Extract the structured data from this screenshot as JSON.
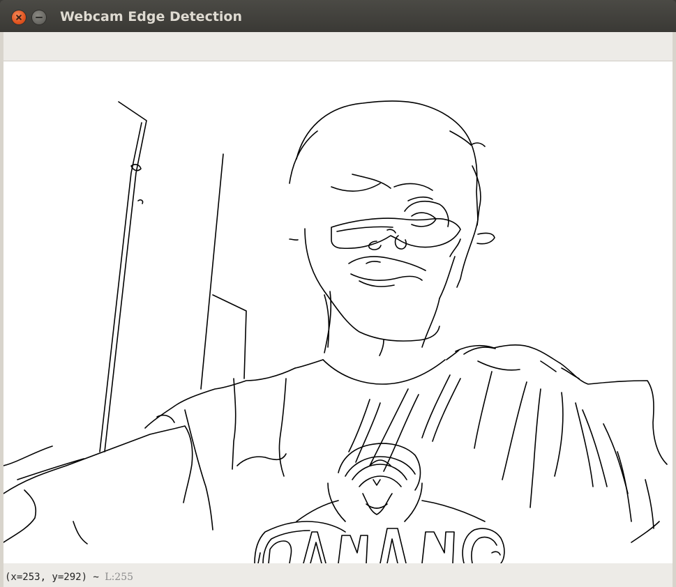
{
  "window": {
    "title": "Webcam Edge Detection",
    "close_icon": "close-icon",
    "minimize_icon": "minimize-icon"
  },
  "canvas": {
    "content": "edge-detection-image"
  },
  "status": {
    "coords": "(x=253, y=292) ~ ",
    "luminance": "L:255"
  }
}
